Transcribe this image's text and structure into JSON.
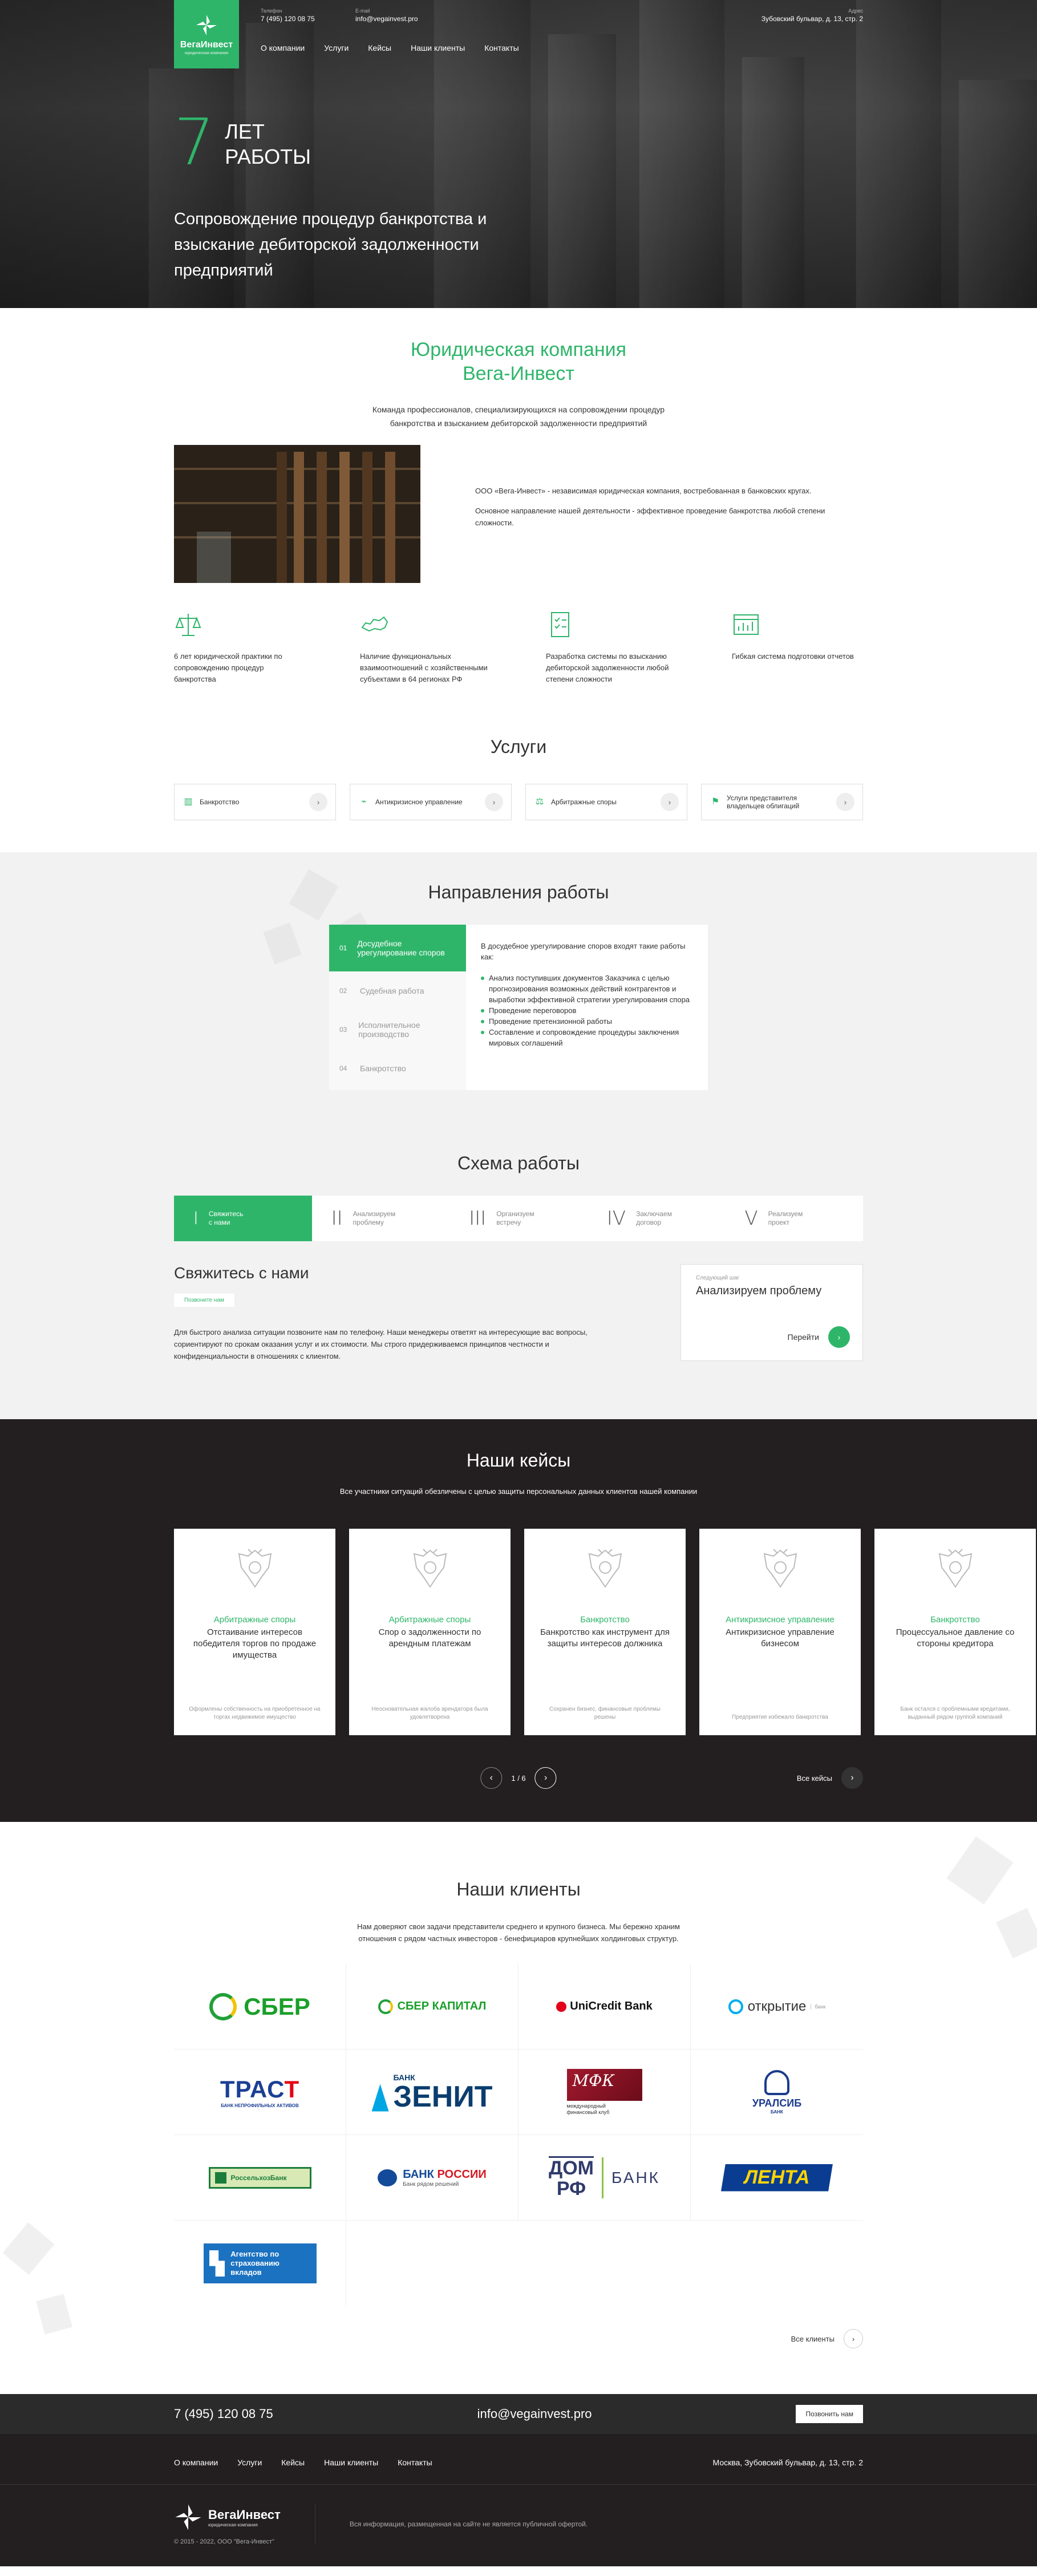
{
  "header": {
    "logo_name": "ВегаИнвест",
    "logo_sub": "юридическая компания",
    "phone_label": "Телефон",
    "phone": "7 (495) 120 08 75",
    "email_label": "E-mail",
    "email": "info@vegainvest.pro",
    "address_label": "Адрес",
    "address": "Зубовский бульвар, д. 13, стр. 2",
    "nav": [
      "О компании",
      "Услуги",
      "Кейсы",
      "Наши клиенты",
      "Контакты"
    ]
  },
  "hero": {
    "years_num": "7",
    "years_line1": "ЛЕТ",
    "years_line2": "РАБОТЫ",
    "title": "Сопровождение процедур банкротства и взыскание дебиторской задолженности предприятий"
  },
  "about": {
    "title_line1": "Юридическая компания",
    "title_line2": "Вега-Инвест",
    "lead_line1": "Команда профессионалов, специализирующихся на сопровождении процедур",
    "lead_line2": "банкротства и взысканием дебиторской задолженности предприятий",
    "para1": "ООО «Вега-Инвест» - независимая юридическая компания, востребованная в банковских кругах.",
    "para2": "Основное направление нашей деятельности - эффективное проведение банкротства любой степени сложности.",
    "features": [
      {
        "icon": "scales-icon",
        "text": "6 лет юридической практики по сопровождению процедур банкротства"
      },
      {
        "icon": "russia-map-icon",
        "text": "Наличие функциональных взаимоотношений с хозяйственными субъектами в 64 регионах РФ"
      },
      {
        "icon": "checklist-icon",
        "text": "Разработка системы по взысканию дебиторской задолженности любой степени сложности"
      },
      {
        "icon": "report-icon",
        "text": "Гибкая система подготовки отчетов"
      }
    ]
  },
  "services": {
    "title": "Услуги",
    "items": [
      {
        "icon": "bank-icon",
        "label": "Банкротство"
      },
      {
        "icon": "chart-icon",
        "label": "Антикризисное управление"
      },
      {
        "icon": "gavel-icon",
        "label": "Арбитражные споры"
      },
      {
        "icon": "flag-icon",
        "label": "Услуги представителя владельцев облигаций"
      }
    ]
  },
  "directions": {
    "title": "Направления работы",
    "tabs": [
      {
        "num": "01",
        "label": "Досудебное урегулирование споров"
      },
      {
        "num": "02",
        "label": "Судебная работа"
      },
      {
        "num": "03",
        "label": "Исполнительное производство"
      },
      {
        "num": "04",
        "label": "Банкротство"
      }
    ],
    "content_intro": "В досудебное урегулирование споров входят такие работы как:",
    "content_items": [
      "Анализ поступивших документов Заказчика с целью прогнозирования возможных действий контрагентов и выработки эффективной стратегии урегулирования спора",
      "Проведение переговоров",
      "Проведение претензионной работы",
      "Составление и сопровождение процедуры заключения мировых соглашений"
    ]
  },
  "scheme": {
    "title": "Схема работы",
    "steps": [
      {
        "roman": "I",
        "line1": "Свяжитесь",
        "line2": "с нами"
      },
      {
        "roman": "II",
        "line1": "Анализируем",
        "line2": "проблему"
      },
      {
        "roman": "III",
        "line1": "Организуем",
        "line2": "встречу"
      },
      {
        "roman": "IV",
        "line1": "Заключаем",
        "line2": "договор"
      },
      {
        "roman": "V",
        "line1": "Реализуем",
        "line2": "проект"
      }
    ],
    "contact_title": "Свяжитесь с нами",
    "contact_button": "Позвоните нам",
    "contact_text": "Для быстрого анализа ситуации позвоните нам по телефону. Наши менеджеры ответят на интересующие вас вопросы, сориентируют по срокам оказания услуг и их стоимости. Мы строго придерживаемся принципов честности и конфиденциальности в отношениях с клиентом.",
    "next_label": "Следующий шаг",
    "next_title": "Анализируем проблему",
    "next_go": "Перейти"
  },
  "cases": {
    "title": "Наши кейсы",
    "lead": "Все участники ситуаций обезличены с целью защиты персональных данных клиентов нашей компании",
    "items": [
      {
        "category": "Арбитражные споры",
        "title": "Отстаивание интересов победителя торгов по продаже имущества",
        "footer": "Оформлены собственность на приобретенное на торгах недвижимое имущество"
      },
      {
        "category": "Арбитражные споры",
        "title": "Спор о задолженности по арендным платежам",
        "footer": "Неосновательная жалоба арендатора была удовлетворена"
      },
      {
        "category": "Банкротство",
        "title": "Банкротство как инструмент для защиты интересов должника",
        "footer": "Сохранен бизнес, финансовые проблемы решены"
      },
      {
        "category": "Антикризисное управление",
        "title": "Антикризисное управление бизнесом",
        "footer": "Предприятие избежало банкротства"
      },
      {
        "category": "Банкротство",
        "title": "Процессуальное давление со стороны кредитора",
        "footer": "Банк остался с проблемными кредитами, выданный рядом группой компаний"
      }
    ],
    "pager": "1 / 6",
    "all": "Все кейсы"
  },
  "clients": {
    "title": "Наши клиенты",
    "lead_line1": "Нам доверяют свои задачи представители среднего и крупного бизнеса. Мы бережно храним",
    "lead_line2": "отношения с рядом частных инвесторов - бенефициаров крупнейших холдинговых структур.",
    "logos": {
      "sber": "СБЕР",
      "sbercap": "СБЕР КАПИТАЛ",
      "unicredit": "UniCredit Bank",
      "otkr": "открытие",
      "otkr_sub": "банк",
      "trast_a": "ТРАС",
      "trast_b": "Т",
      "trast_sub": "БАНК НЕПРОФИЛЬНЫХ АКТИВОВ",
      "zenit_b": "БАНК",
      "zenit": "ЗЕНИТ",
      "mfk": "МФК",
      "mfk_sub": "международный финансовый клуб",
      "uralsib": "УРАЛСИБ",
      "uralsib_sub": "БАНК",
      "rossel": "РоссельхозБанк",
      "cbr_a": "БАНК ",
      "cbr_b": "РОССИИ",
      "cbr_sub": "Банк рядом решений",
      "domrf_a": "ДОМ",
      "domrf_b": "РФ",
      "domrf_bank": "БАНК",
      "lenta": "ЛЕНТА",
      "asv": "Агентство по страхованию вкладов"
    },
    "all": "Все клиенты"
  },
  "footer": {
    "phone": "7 (495) 120 08 75",
    "email": "info@vegainvest.pro",
    "call_button": "Позвонить нам",
    "nav": [
      "О компании",
      "Услуги",
      "Кейсы",
      "Наши клиенты",
      "Контакты"
    ],
    "address": "Москва, Зубовский бульвар, д. 13, стр. 2",
    "logo_name": "ВегаИнвест",
    "logo_sub": "юридическая компания",
    "copyright": "© 2015 - 2022, ООО \"Вега-Инвест\"",
    "note": "Вся информация, размещенная на сайте не является публичной офертой."
  }
}
